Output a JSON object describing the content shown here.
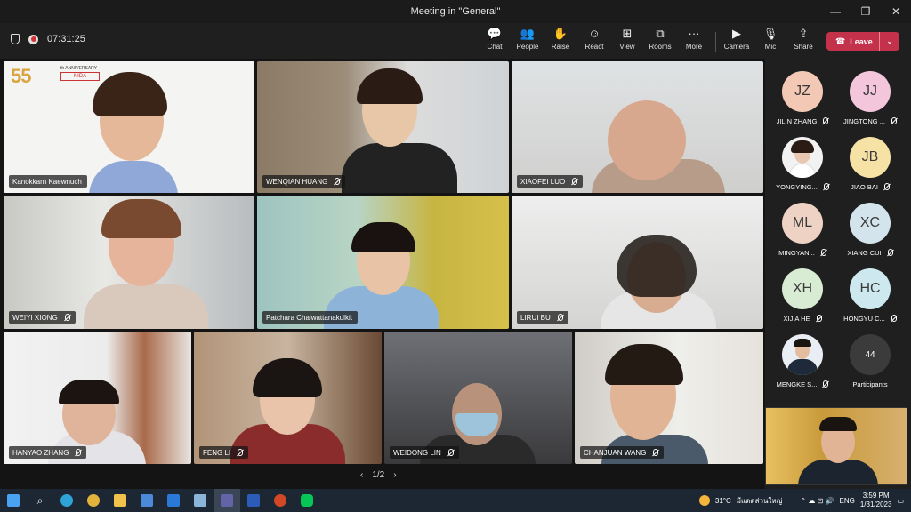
{
  "window": {
    "title": "Meeting in \"General\"",
    "minimize": "—",
    "maximize": "❐",
    "close": "✕"
  },
  "toolbar": {
    "timer": "07:31:25",
    "buttons": [
      {
        "label": "Chat",
        "icon": "chat-icon",
        "glyph": "💬"
      },
      {
        "label": "People",
        "icon": "people-icon",
        "glyph": "👥"
      },
      {
        "label": "Raise",
        "icon": "raise-hand-icon",
        "glyph": "✋"
      },
      {
        "label": "React",
        "icon": "react-icon",
        "glyph": "☺"
      },
      {
        "label": "View",
        "icon": "view-icon",
        "glyph": "⊞"
      },
      {
        "label": "Rooms",
        "icon": "rooms-icon",
        "glyph": "⧉"
      },
      {
        "label": "More",
        "icon": "more-icon",
        "glyph": "···"
      },
      {
        "label": "Camera",
        "icon": "camera-icon",
        "glyph": "▶"
      },
      {
        "label": "Mic",
        "icon": "mic-off-icon",
        "glyph": "🎙"
      },
      {
        "label": "Share",
        "icon": "share-icon",
        "glyph": "⇪"
      }
    ],
    "leave_label": "Leave",
    "leave_icon": "☎",
    "leave_caret": "⌄"
  },
  "tiles": [
    {
      "name": "Kanokkarn Kaewnuch",
      "muted": false
    },
    {
      "name": "WENQIAN HUANG",
      "muted": true
    },
    {
      "name": "XIAOFEI LUO",
      "muted": true
    },
    {
      "name": "WEIYI XIONG",
      "muted": true
    },
    {
      "name": "Patchara Chaiwattanakulkit",
      "muted": false
    },
    {
      "name": "LIRUI BU",
      "muted": true
    },
    {
      "name": "HANYAO ZHANG",
      "muted": true
    },
    {
      "name": "FENG LI",
      "muted": true
    },
    {
      "name": "WEIDONG LIN",
      "muted": true
    },
    {
      "name": "CHANJUAN WANG",
      "muted": true
    }
  ],
  "logo": {
    "number": "55",
    "text": "th ANNIVERSARY",
    "brand": "NIDA"
  },
  "pager": {
    "prev": "‹",
    "label": "1/2",
    "next": "›"
  },
  "roster": [
    {
      "initials": "JZ",
      "name": "JILIN ZHANG",
      "color": "#f3c9b6"
    },
    {
      "initials": "JJ",
      "name": "JINGTONG ...",
      "color": "#f4c6dc"
    },
    {
      "initials": "",
      "name": "YONGYING...",
      "color": "#f2f2f2"
    },
    {
      "initials": "JB",
      "name": "JIAO BAI",
      "color": "#f7e2a6"
    },
    {
      "initials": "ML",
      "name": "MINGYAN...",
      "color": "#eed2c4"
    },
    {
      "initials": "XC",
      "name": "XIANG CUI",
      "color": "#d3e4ec"
    },
    {
      "initials": "XH",
      "name": "XIJIA HE",
      "color": "#d7ecd3"
    },
    {
      "initials": "HC",
      "name": "HONGYU C...",
      "color": "#cde8ee"
    },
    {
      "initials": "",
      "name": "MENGKE S...",
      "color": "#e9eef5"
    },
    {
      "initials": "44",
      "name": "Participants",
      "color": "#3b3b3b"
    }
  ],
  "taskbar": {
    "weather": "31°C",
    "location": "มีแดดส่วนใหญ่",
    "lang": "ENG",
    "time": "3:59 PM",
    "date": "1/31/2023",
    "search_glyph": "⌕",
    "tray_glyphs": "⌃  ☁ ⊡ 🔊",
    "notification_glyph": "▭",
    "apps": [
      {
        "icon": "windows-start-icon",
        "color": "#4aa3f0"
      },
      {
        "icon": "search-icon",
        "color": "transparent"
      },
      {
        "icon": "edge-icon",
        "color": "#2fa3d8"
      },
      {
        "icon": "chrome-icon",
        "color": "#e2b33c"
      },
      {
        "icon": "file-explorer-icon",
        "color": "#f0c24b"
      },
      {
        "icon": "store-icon",
        "color": "#4a8ad8"
      },
      {
        "icon": "mail-icon",
        "color": "#2a79d6"
      },
      {
        "icon": "app-icon",
        "color": "#8ab4d8"
      },
      {
        "icon": "teams-icon",
        "color": "#6264a7"
      },
      {
        "icon": "word-icon",
        "color": "#2b5cb8"
      },
      {
        "icon": "powerpoint-icon",
        "color": "#d24726"
      },
      {
        "icon": "line-icon",
        "color": "#06c755"
      }
    ]
  }
}
